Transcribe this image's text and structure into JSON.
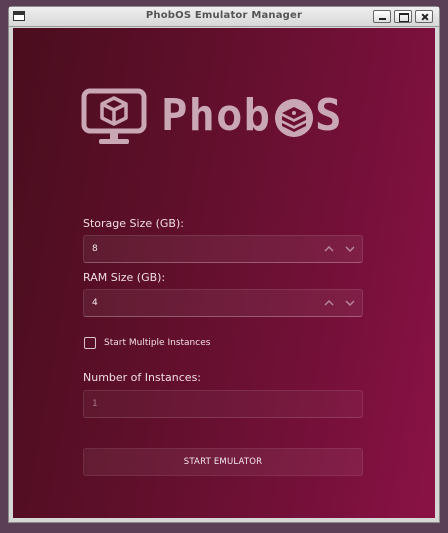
{
  "window": {
    "title": "PhobOS Emulator Manager"
  },
  "logo": {
    "text_prefix": "Phob",
    "text_suffix": "S",
    "icon": "monitor-cube-icon",
    "badge_icon": "stacked-box-icon",
    "color": "#c9a7b4"
  },
  "form": {
    "storage": {
      "label": "Storage Size (GB):",
      "value": "8"
    },
    "ram": {
      "label": "RAM Size (GB):",
      "value": "4"
    },
    "multiple": {
      "label": "Start Multiple Instances",
      "checked": false
    },
    "instances": {
      "label": "Number of Instances:",
      "value": "1"
    },
    "start_button": "START EMULATOR"
  },
  "colors": {
    "background_start": "#4a0d1e",
    "background_end": "#8a1245",
    "text": "#f0dde4"
  }
}
